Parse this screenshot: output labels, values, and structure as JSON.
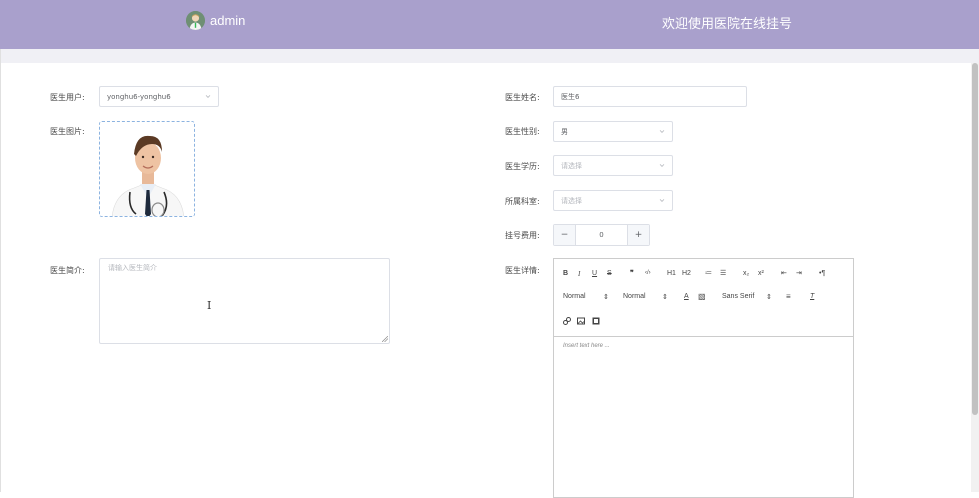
{
  "header": {
    "username": "admin",
    "site_title": "欢迎使用医院在线挂号"
  },
  "form": {
    "doctor_user": {
      "label": "医生用户:",
      "value": "yonghu6-yonghu6"
    },
    "doctor_image": {
      "label": "医生图片:"
    },
    "doctor_intro": {
      "label": "医生简介:",
      "placeholder": "请输入医生简介"
    },
    "doctor_name": {
      "label": "医生姓名:",
      "value": "医生6"
    },
    "doctor_gender": {
      "label": "医生性别:",
      "value": "男"
    },
    "doctor_education": {
      "label": "医生学历:",
      "placeholder": "请选择"
    },
    "department": {
      "label": "所属科室:",
      "placeholder": "请选择"
    },
    "fee": {
      "label": "挂号费用:",
      "value": "0",
      "minus": "−",
      "plus": "+"
    },
    "doctor_detail": {
      "label": "医生详情:"
    }
  },
  "editor": {
    "toolbar_row1": [
      "B",
      "I",
      "U",
      "S",
      "❞",
      "‹/›",
      "H1",
      "H2",
      "≔",
      "☰",
      "x₂",
      "x²",
      "⇤",
      "⇥",
      "•¶"
    ],
    "header_select": "Normal",
    "size_select": "Normal",
    "font_select": "Sans Serif",
    "placeholder": "Insert text here ..."
  },
  "colors": {
    "header_bg": "#a9a0cc",
    "accent": "#8cb3e0"
  }
}
